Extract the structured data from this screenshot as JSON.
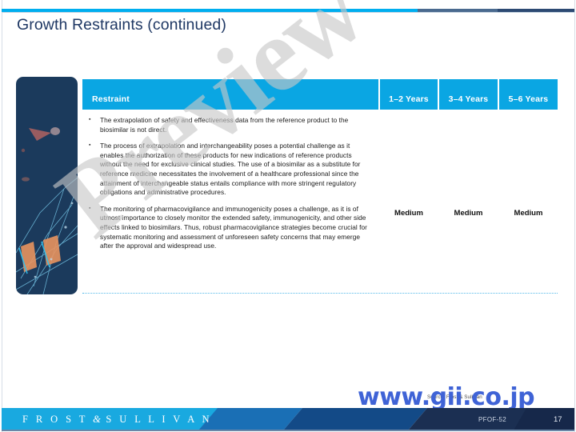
{
  "slide": {
    "title": "Growth Restraints (continued)",
    "page_number": "17",
    "document_code": "PFOF-52",
    "source_note": "Source: Frost & Sullivan",
    "watermark_text": "Preview",
    "site_watermark": "www.gii.co.jp",
    "brand": {
      "left": "F R O S T",
      "amp": "&",
      "right": "S U L L I V A N"
    }
  },
  "colors": {
    "accent_cyan": "#00aeef",
    "table_header": "#0aa6e3",
    "title_navy": "#1f3864",
    "footer_cyan": "#19a9e0",
    "footer_navy": "#1b2f52",
    "divider_dotted": "#54b9e8",
    "watermark_gray": "#c8c8c8",
    "gii_blue": "#3f63d6"
  },
  "table": {
    "columns": [
      {
        "key": "restraint",
        "label": "Restraint"
      },
      {
        "key": "y1_2",
        "label": "1–2 Years"
      },
      {
        "key": "y3_4",
        "label": "3–4 Years"
      },
      {
        "key": "y5_6",
        "label": "5–6 Years"
      }
    ],
    "rows": [
      {
        "bullets": [
          "The extrapolation of safety and effectiveness data from the reference product to the biosimilar is not direct.",
          "The process of extrapolation and interchangeability poses a potential challenge as it enables the authorization of these products for new indications of reference products without the need for exclusive clinical studies. The use of a biosimilar as a substitute for reference medicine necessitates the involvement of a healthcare professional since the attainment of interchangeable status entails compliance with more stringent regulatory obligations and administrative procedures.",
          "The monitoring of pharmacovigilance and immunogenicity poses a challenge, as it is of utmost importance to closely monitor the extended safety, immunogenicity, and other side effects linked to biosimilars. Thus, robust pharmacovigilance strategies become crucial for systematic monitoring and assessment of unforeseen safety concerns that may emerge after the approval and widespread use."
        ],
        "ratings": {
          "y1_2": "Medium",
          "y3_4": "Medium",
          "y5_6": "Medium"
        }
      }
    ]
  }
}
